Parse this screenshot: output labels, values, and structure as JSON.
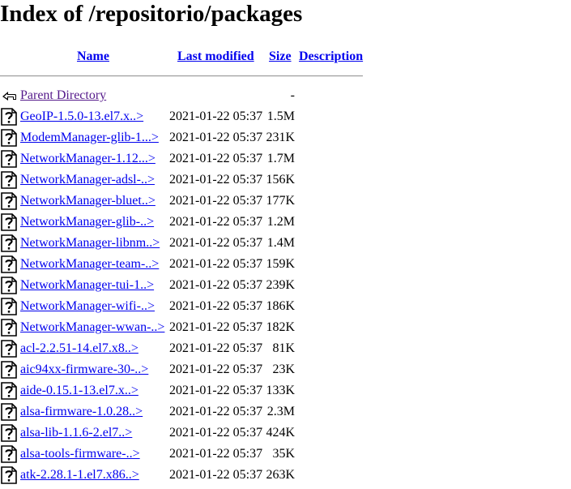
{
  "title": "Index of /repositorio/packages",
  "headers": {
    "name": "Name",
    "last_modified": "Last modified",
    "size": "Size",
    "description": "Description"
  },
  "parent": {
    "label": "Parent Directory",
    "size": "-"
  },
  "files": [
    {
      "name": "GeoIP-1.5.0-13.el7.x..>",
      "modified": "2021-01-22 05:37",
      "size": "1.5M"
    },
    {
      "name": "ModemManager-glib-1...>",
      "modified": "2021-01-22 05:37",
      "size": "231K"
    },
    {
      "name": "NetworkManager-1.12...>",
      "modified": "2021-01-22 05:37",
      "size": "1.7M"
    },
    {
      "name": "NetworkManager-adsl-..>",
      "modified": "2021-01-22 05:37",
      "size": "156K"
    },
    {
      "name": "NetworkManager-bluet..>",
      "modified": "2021-01-22 05:37",
      "size": "177K"
    },
    {
      "name": "NetworkManager-glib-..>",
      "modified": "2021-01-22 05:37",
      "size": "1.2M"
    },
    {
      "name": "NetworkManager-libnm..>",
      "modified": "2021-01-22 05:37",
      "size": "1.4M"
    },
    {
      "name": "NetworkManager-team-..>",
      "modified": "2021-01-22 05:37",
      "size": "159K"
    },
    {
      "name": "NetworkManager-tui-1..>",
      "modified": "2021-01-22 05:37",
      "size": "239K"
    },
    {
      "name": "NetworkManager-wifi-..>",
      "modified": "2021-01-22 05:37",
      "size": "186K"
    },
    {
      "name": "NetworkManager-wwan-..>",
      "modified": "2021-01-22 05:37",
      "size": "182K"
    },
    {
      "name": "acl-2.2.51-14.el7.x8..>",
      "modified": "2021-01-22 05:37",
      "size": "81K"
    },
    {
      "name": "aic94xx-firmware-30-..>",
      "modified": "2021-01-22 05:37",
      "size": "23K"
    },
    {
      "name": "aide-0.15.1-13.el7.x..>",
      "modified": "2021-01-22 05:37",
      "size": "133K"
    },
    {
      "name": "alsa-firmware-1.0.28..>",
      "modified": "2021-01-22 05:37",
      "size": "2.3M"
    },
    {
      "name": "alsa-lib-1.1.6-2.el7..>",
      "modified": "2021-01-22 05:37",
      "size": "424K"
    },
    {
      "name": "alsa-tools-firmware-..>",
      "modified": "2021-01-22 05:37",
      "size": "35K"
    },
    {
      "name": "atk-2.28.1-1.el7.x86..>",
      "modified": "2021-01-22 05:37",
      "size": "263K"
    }
  ],
  "icons": {
    "parent": "back-arrow-icon",
    "file": "unknown-file-icon"
  },
  "colors": {
    "link": "#0000ee",
    "visited": "#551a8b"
  }
}
